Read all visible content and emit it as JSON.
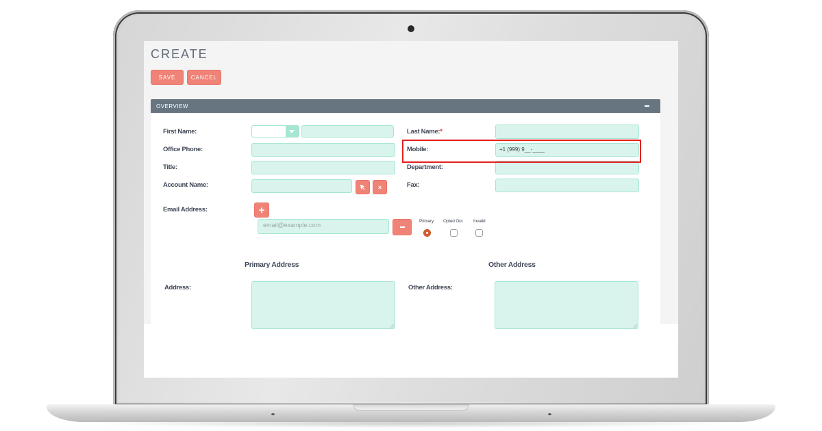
{
  "page": {
    "title": "CREATE",
    "buttons": {
      "save": "SAVE",
      "cancel": "CANCEL"
    }
  },
  "panel": {
    "title": "OVERVIEW",
    "collapse_icon": "minus-icon"
  },
  "form": {
    "first_name": {
      "label": "First Name:",
      "salutation_value": "",
      "value": ""
    },
    "last_name": {
      "label": "Last Name:",
      "required_marker": "*",
      "value": ""
    },
    "office_phone": {
      "label": "Office Phone:",
      "value": ""
    },
    "mobile": {
      "label": "Mobile:",
      "value": "+1 (999) 9__-____"
    },
    "title": {
      "label": "Title:",
      "value": ""
    },
    "department": {
      "label": "Department:",
      "value": ""
    },
    "account_name": {
      "label": "Account Name:",
      "value": "",
      "select_icon": "cursor-arrow-icon",
      "clear_icon": "close-icon"
    },
    "fax": {
      "label": "Fax:",
      "value": ""
    },
    "email": {
      "label": "Email Address:",
      "add_icon": "plus-icon",
      "remove_icon": "minus-icon",
      "placeholder": "email@example.com",
      "value": "",
      "flags": [
        {
          "label": "Primary",
          "type": "radio",
          "checked": true
        },
        {
          "label": "Opted Out",
          "type": "checkbox",
          "checked": false
        },
        {
          "label": "Invalid",
          "type": "checkbox",
          "checked": false
        }
      ]
    },
    "primary_address": {
      "section_title": "Primary Address",
      "label": "Address:",
      "value": ""
    },
    "other_address": {
      "section_title": "Other Address",
      "label": "Other Address:",
      "value": ""
    }
  },
  "colors": {
    "accent_button": "#f08377",
    "panel_header": "#677581",
    "input_bg": "#d8f4ec",
    "input_border": "#a6e6d3",
    "highlight": "#e51e1e",
    "radio_selected": "#d5602e"
  }
}
